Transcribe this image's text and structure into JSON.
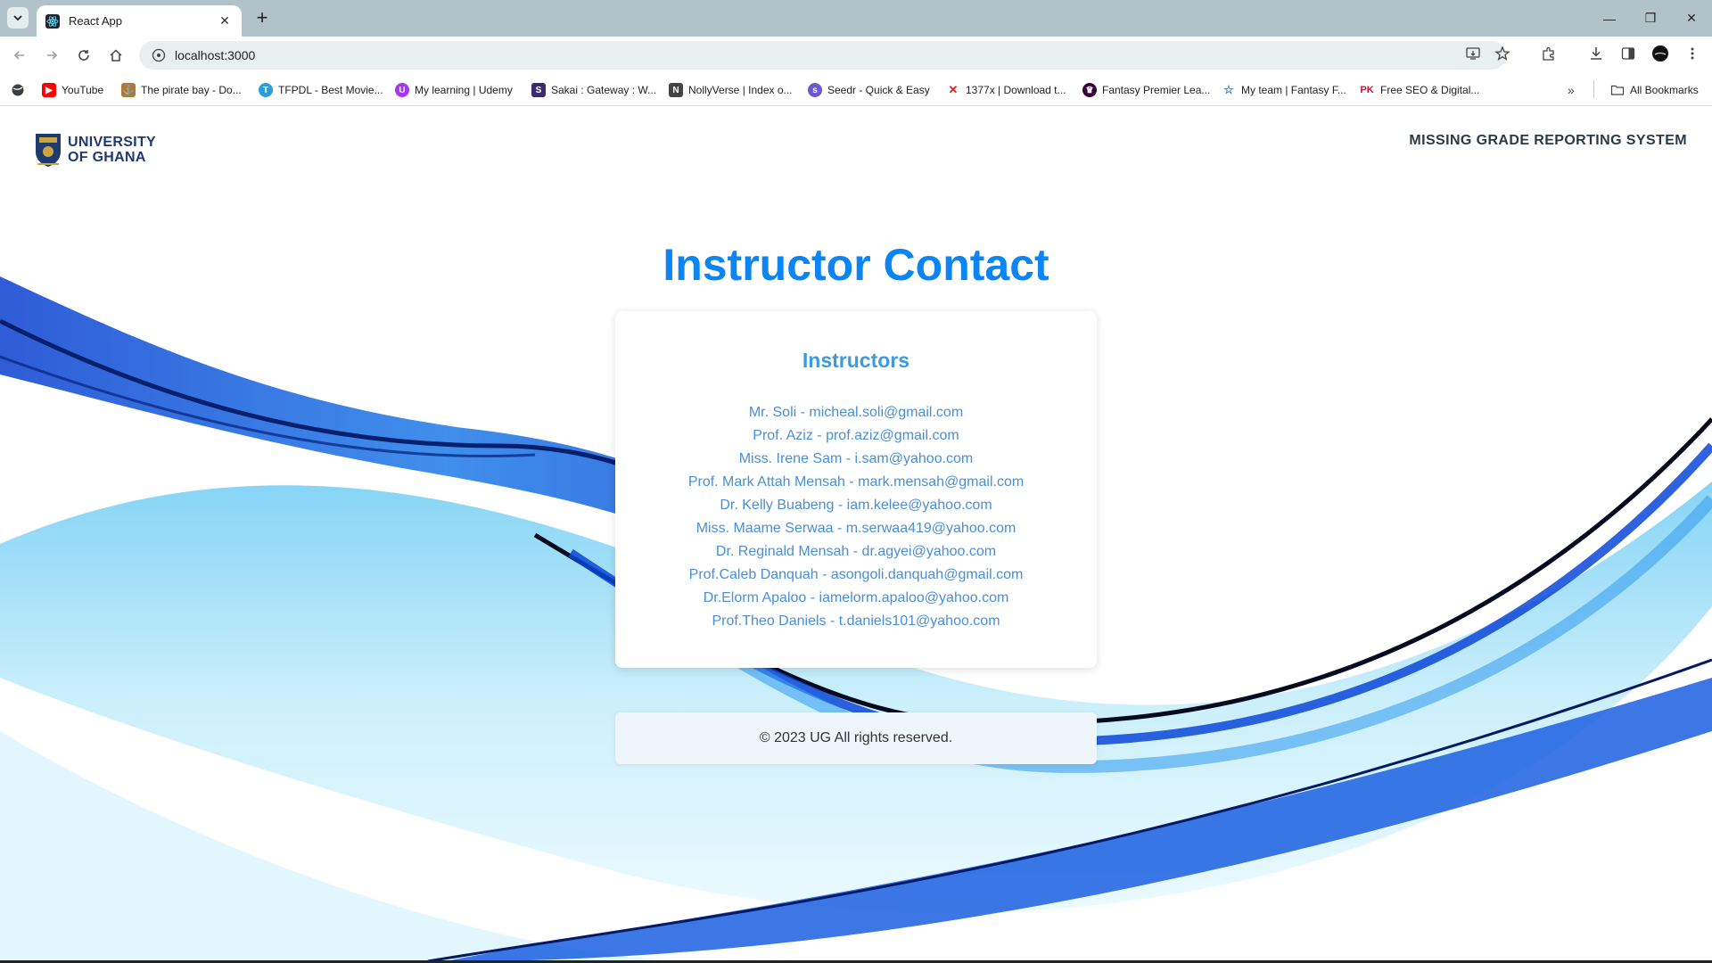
{
  "browser": {
    "tab_title": "React App",
    "url": "localhost:3000",
    "bookmarks": [
      {
        "label": "YouTube",
        "color": "#ff0000"
      },
      {
        "label": "The pirate bay - Do...",
        "color": "#b07a3a"
      },
      {
        "label": "TFPDL - Best Movie...",
        "color": "#2a9fd8"
      },
      {
        "label": "My learning | Udemy",
        "color": "#a435f0"
      },
      {
        "label": "Sakai : Gateway : W...",
        "color": "#3b2a6e"
      },
      {
        "label": "NollyVerse | Index o...",
        "color": "#444444"
      },
      {
        "label": "Seedr - Quick & Easy",
        "color": "#6a5acd"
      },
      {
        "label": "1377x | Download t...",
        "color": "#e02020"
      },
      {
        "label": "Fantasy Premier Lea...",
        "color": "#37003c"
      },
      {
        "label": "My team | Fantasy F...",
        "color": "#3a7bd5"
      },
      {
        "label": "Free SEO & Digital...",
        "color": "#d0103a"
      }
    ],
    "bookmark_pk_icon": "PK",
    "all_bookmarks": "All Bookmarks"
  },
  "header": {
    "logo_line1": "UNIVERSITY",
    "logo_line2": "OF GHANA",
    "system_title": "MISSING GRADE REPORTING SYSTEM"
  },
  "main": {
    "heading": "Instructor Contact",
    "card_title": "Instructors",
    "instructors": [
      "Mr. Soli - micheal.soli@gmail.com",
      "Prof. Aziz - prof.aziz@gmail.com",
      "Miss. Irene Sam - i.sam@yahoo.com",
      "Prof. Mark Attah Mensah - mark.mensah@gmail.com",
      "Dr. Kelly Buabeng - iam.kelee@yahoo.com",
      "Miss. Maame Serwaa - m.serwaa419@yahoo.com",
      "Dr. Reginald Mensah - dr.agyei@yahoo.com",
      "Prof.Caleb Danquah - asongoli.danquah@gmail.com",
      "Dr.Elorm Apaloo - iamelorm.apaloo@yahoo.com",
      "Prof.Theo Daniels - t.daniels101@yahoo.com"
    ]
  },
  "footer": {
    "text": "© 2023 UG All rights reserved."
  },
  "colors": {
    "heading": "#0b84f4",
    "card_title": "#3b9ae1",
    "instructor_text": "#4a8fd6",
    "tabstrip": "#b1c3c8"
  }
}
